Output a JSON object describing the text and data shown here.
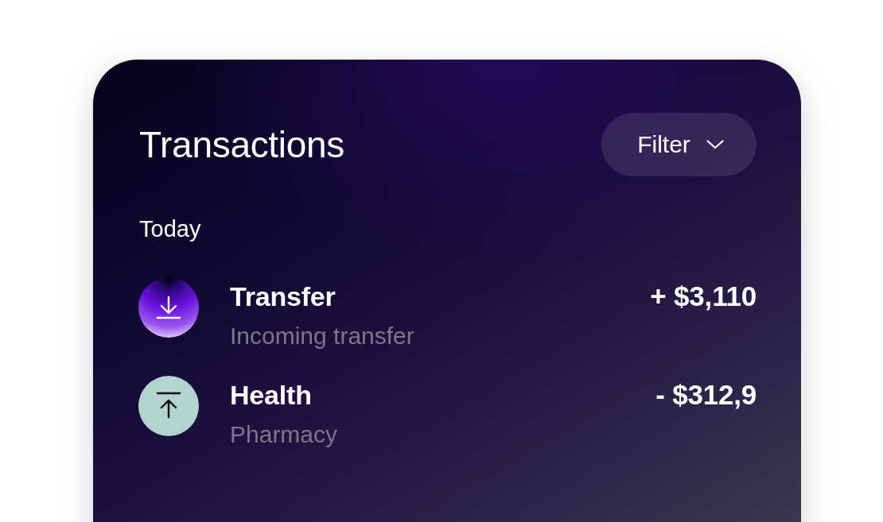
{
  "header": {
    "title": "Transactions",
    "filter_button": {
      "label": "Filter"
    }
  },
  "groups": [
    {
      "label": "Today",
      "transactions": [
        {
          "kind": "incoming",
          "title": "Transfer",
          "subtitle": "Incoming transfer",
          "amount": "+ $3,110"
        },
        {
          "kind": "outgoing",
          "title": "Health",
          "subtitle": "Pharmacy",
          "amount": "- $312,9"
        }
      ]
    }
  ]
}
